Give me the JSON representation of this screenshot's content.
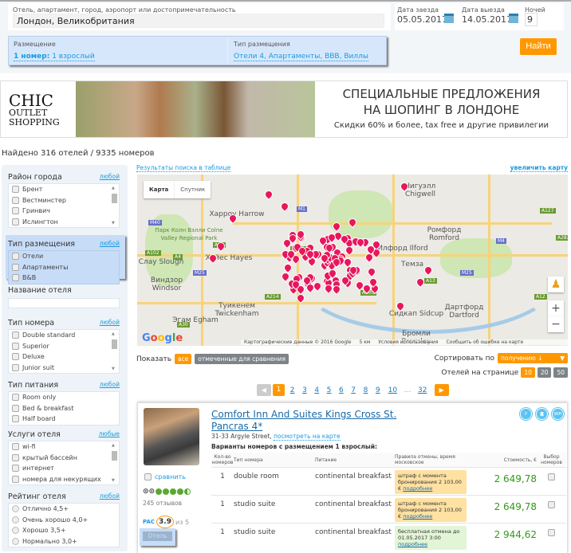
{
  "search": {
    "destination_label": "Отель, апартамент, город, аэропорт или достопримечательность",
    "destination_value": "Лондон, Великобритания",
    "checkin_label": "Дата заезда",
    "checkin_value": "05.05.2017",
    "checkout_label": "Дата выезда",
    "checkout_value": "14.05.2017",
    "nights_label": "Ночей",
    "nights_value": "9",
    "rooms_label": "Размещение",
    "rooms_value_bold": "1 номер:",
    "rooms_value": "1 взрослый",
    "acc_type_label": "Тип размещения",
    "acc_type_value": "Отели 4, Апартаменты, BBB, Виллы",
    "find_button": "Найти"
  },
  "banner": {
    "logo_line1": "CHIC",
    "logo_line2": "OUTLET",
    "logo_line3": "SHOPPING",
    "headline1": "СПЕЦИАЛЬНЫЕ ПРЕДЛОЖЕНИЯ",
    "headline2": "НА ШОПИНГ В ЛОНДОНЕ",
    "subline": "Скидки 60% и более, tax free и другие привилегии"
  },
  "found_text": "Найдено 316 отелей / 9335 номеров",
  "filters": {
    "district": {
      "title": "Район города",
      "any": "любой",
      "items": [
        "Брент",
        "Вестминстер",
        "Гринвич",
        "Ислингтон"
      ]
    },
    "acc_type": {
      "title": "Тип размещения",
      "any": "любой",
      "items": [
        "Отели",
        "Апартаменты",
        "B&B"
      ]
    },
    "hotel_name": {
      "title": "Название отеля",
      "value": ""
    },
    "room_type": {
      "title": "Тип номера",
      "any": "любой",
      "items": [
        "Double standard",
        "Superior",
        "Deluxe",
        "Junior suit"
      ]
    },
    "meal": {
      "title": "Тип питания",
      "any": "любой",
      "items": [
        "Room only",
        "Bed & breakfast",
        "Half board"
      ]
    },
    "services": {
      "title": "Услуги отеля",
      "any": "любые",
      "items": [
        "wi-fi",
        "крытый бассейн",
        "интернет",
        "номера для некурящих"
      ]
    },
    "rating": {
      "title": "Рейтинг отеля",
      "any": "любой",
      "items": [
        "Отлично 4,5+",
        "Очень хорошо 4,0+",
        "Хорошо 3,5+",
        "Нормально 3,0+"
      ]
    }
  },
  "map": {
    "table_link": "Результаты поиска в таблице",
    "enlarge_link": "увеличить карту",
    "tab_map": "Карта",
    "tab_satellite": "Спутник",
    "labels": [
      "Чигуэлл Chigwell",
      "Харроу Harrow",
      "Парк Колн Вэлли Colne Valley Regional Park",
      "Ромфорд Romford",
      "Илфорд Ilford",
      "Слау Slough",
      "Хайес Hayes",
      "Виндзор Windsor",
      "Туикенем Twickenham",
      "Дартфорд Dartford",
      "Сидкап Sidcup",
      "Бромли Bromley",
      "Эгам Egham",
      "Темза"
    ],
    "road_shields": [
      "M40",
      "M1",
      "M25",
      "A406",
      "A40",
      "M25",
      "M4",
      "A4",
      "A205",
      "A214",
      "A102",
      "A13",
      "A12",
      "A127",
      "A282",
      "A30"
    ],
    "google": "Google",
    "attribution": "Картографические данные © 2016 Google",
    "scale": "5 км",
    "terms": "Условия использования",
    "report": "Сообщить об ошибке на карте",
    "zoom_in": "+",
    "zoom_out": "−",
    "marker_color": "#e8175d"
  },
  "controls": {
    "show_label": "Показать",
    "show_all": "все",
    "show_compare": "отмеченные для сравнения",
    "sort_label": "Сортировать по",
    "sort_value": "получению ↓",
    "per_page_label": "Отелей на странице",
    "per_page_options": [
      "10",
      "20",
      "50"
    ],
    "per_page_selected": "10"
  },
  "pagination": {
    "pages": [
      "1",
      "2",
      "3",
      "4",
      "5",
      "6",
      "7",
      "8",
      "9",
      "10",
      "...",
      "32"
    ],
    "current": "1"
  },
  "hotel": {
    "name": "Comfort Inn And Suites Kings Cross St. Pancras 4*",
    "address": "31-33 Argyle Street,",
    "map_link": "посмотреть на карте",
    "variants_title": "Варианты номеров с размещением 1 взрослый:",
    "compare": "сравнить",
    "reviews": "245 отзывов",
    "tripadvisor_rating": 4.5,
    "pac_label": "PAC",
    "pac_score": "3.9",
    "pac_of": "из 5",
    "hotel_button": "Отель",
    "amenities": [
      "parking-icon",
      "laundry-icon",
      "wifi-icon"
    ],
    "columns": [
      "Кол-во номеров",
      "Тип номера",
      "Питание",
      "Правила отмены, время московское",
      "Стоимость, €",
      "Выбор номеров"
    ],
    "rooms": [
      {
        "qty": "1",
        "type": "double room",
        "meal": "continental breakfast",
        "policy": "штраф с момента бронирования 2 103,00 €",
        "more": "подробнее",
        "policy_kind": "fee",
        "price": "2 649,78"
      },
      {
        "qty": "1",
        "type": "studio suite",
        "meal": "continental breakfast",
        "policy": "штраф с момента бронирования 2 103,00 €",
        "more": "подробнее",
        "policy_kind": "fee",
        "price": "2 649,78"
      },
      {
        "qty": "1",
        "type": "studio suite",
        "meal": "continental breakfast",
        "policy": "бесплатная отмена до 01.05.2017 3:00",
        "more": "подробнее",
        "policy_kind": "free",
        "price": "2 944,62"
      }
    ]
  },
  "colors": {
    "accent": "#ff9800",
    "link": "#1a9be0",
    "price": "#2e9c1a",
    "panel": "#d7e7fb"
  }
}
